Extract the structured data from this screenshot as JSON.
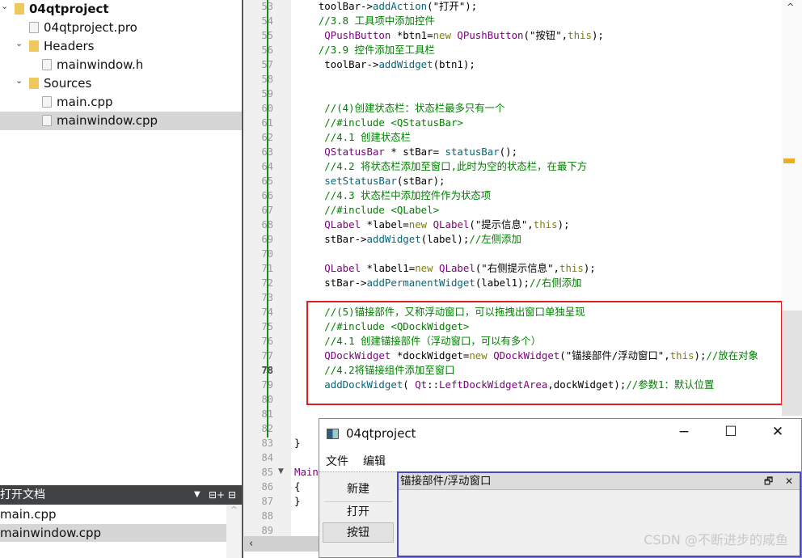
{
  "project_tree": [
    {
      "label": "04qtproject",
      "icon": "qt-project-folder-icon",
      "depth": 0,
      "chevron": "expanded",
      "bold": true
    },
    {
      "label": "04qtproject.pro",
      "icon": "qt-pro-file-icon",
      "depth": 1
    },
    {
      "label": "Headers",
      "icon": "headers-folder-icon",
      "depth": 1,
      "chevron": "expanded"
    },
    {
      "label": "mainwindow.h",
      "icon": "header-file-icon",
      "depth": 2
    },
    {
      "label": "Sources",
      "icon": "sources-folder-icon",
      "depth": 1,
      "chevron": "expanded"
    },
    {
      "label": "main.cpp",
      "icon": "cpp-file-icon",
      "depth": 2
    },
    {
      "label": "mainwindow.cpp",
      "icon": "cpp-file-icon",
      "depth": 2,
      "selected": true
    }
  ],
  "open_docs": {
    "title": "打开文档",
    "items": [
      "main.cpp",
      "mainwindow.cpp"
    ],
    "selected": "mainwindow.cpp"
  },
  "editor": {
    "current_line": 78,
    "lines": [
      {
        "n": 53,
        "t": [
          [
            "",
            "    toolBar->"
          ],
          [
            "f",
            "addAction"
          ],
          [
            "",
            "(\"打开\");"
          ]
        ]
      },
      {
        "n": 54,
        "t": [
          [
            "c",
            "    //3.8 工具项中添加控件"
          ]
        ]
      },
      {
        "n": 55,
        "t": [
          [
            "k",
            "     QPushButton"
          ],
          [
            "",
            " *btn1="
          ],
          [
            "o",
            "new"
          ],
          [
            "k",
            " QPushButton"
          ],
          [
            "",
            "(\"按钮\","
          ],
          [
            "o",
            "this"
          ],
          [
            "",
            ");"
          ]
        ]
      },
      {
        "n": 56,
        "t": [
          [
            "c",
            "    //3.9 控件添加至工具栏"
          ]
        ]
      },
      {
        "n": 57,
        "t": [
          [
            "",
            "     toolBar->"
          ],
          [
            "f",
            "addWidget"
          ],
          [
            "",
            "(btn1);"
          ]
        ]
      },
      {
        "n": 58,
        "t": []
      },
      {
        "n": 59,
        "t": []
      },
      {
        "n": 60,
        "t": [
          [
            "c",
            "     //(4)创建状态栏：状态栏最多只有一个"
          ]
        ]
      },
      {
        "n": 61,
        "t": [
          [
            "c",
            "     //#include <QStatusBar>"
          ]
        ]
      },
      {
        "n": 62,
        "t": [
          [
            "c",
            "     //4.1 创建状态栏"
          ]
        ]
      },
      {
        "n": 63,
        "t": [
          [
            "k",
            "     QStatusBar"
          ],
          [
            "",
            " * stBar= "
          ],
          [
            "f",
            "statusBar"
          ],
          [
            "",
            "();"
          ]
        ]
      },
      {
        "n": 64,
        "t": [
          [
            "c",
            "     //4.2 将状态栏添加至窗口,此时为空的状态栏，在最下方"
          ]
        ]
      },
      {
        "n": 65,
        "t": [
          [
            "f",
            "     setStatusBar"
          ],
          [
            "",
            "(stBar);"
          ]
        ]
      },
      {
        "n": 66,
        "t": [
          [
            "c",
            "     //4.3 状态栏中添加控件作为状态项"
          ]
        ]
      },
      {
        "n": 67,
        "t": [
          [
            "c",
            "     //#include <QLabel>"
          ]
        ]
      },
      {
        "n": 68,
        "t": [
          [
            "k",
            "     QLabel"
          ],
          [
            "",
            " *label="
          ],
          [
            "o",
            "new"
          ],
          [
            "k",
            " QLabel"
          ],
          [
            "",
            "(\"提示信息\","
          ],
          [
            "o",
            "this"
          ],
          [
            "",
            ");"
          ]
        ]
      },
      {
        "n": 69,
        "t": [
          [
            "",
            "     stBar->"
          ],
          [
            "f",
            "addWidget"
          ],
          [
            "",
            "(label);"
          ],
          [
            "c",
            "//左侧添加"
          ]
        ]
      },
      {
        "n": 70,
        "t": []
      },
      {
        "n": 71,
        "t": [
          [
            "k",
            "     QLabel"
          ],
          [
            "",
            " *label1="
          ],
          [
            "o",
            "new"
          ],
          [
            "k",
            " QLabel"
          ],
          [
            "",
            "(\"右侧提示信息\","
          ],
          [
            "o",
            "this"
          ],
          [
            "",
            ");"
          ]
        ]
      },
      {
        "n": 72,
        "t": [
          [
            "",
            "     stBar->"
          ],
          [
            "f",
            "addPermanentWidget"
          ],
          [
            "",
            "(label1);"
          ],
          [
            "c",
            "//右侧添加"
          ]
        ]
      },
      {
        "n": 73,
        "t": []
      },
      {
        "n": 74,
        "t": [
          [
            "c",
            "     //(5)锚接部件，又称浮动窗口，可以拖拽出窗口单独呈现"
          ]
        ]
      },
      {
        "n": 75,
        "t": [
          [
            "c",
            "     //#include <QDockWidget>"
          ]
        ]
      },
      {
        "n": 76,
        "t": [
          [
            "c",
            "     //4.1 创建锚接部件（浮动窗口，可以有多个）"
          ]
        ]
      },
      {
        "n": 77,
        "t": [
          [
            "k",
            "     QDockWidget"
          ],
          [
            "",
            " *dockWidget="
          ],
          [
            "o",
            "new"
          ],
          [
            "k",
            " QDockWidget"
          ],
          [
            "",
            "(\"锚接部件/浮动窗口\","
          ],
          [
            "o",
            "this"
          ],
          [
            "",
            ");"
          ],
          [
            "c",
            "//放在对象"
          ]
        ]
      },
      {
        "n": 78,
        "t": [
          [
            "c",
            "     //4.2将锚接组件添加至窗口"
          ]
        ]
      },
      {
        "n": 79,
        "t": [
          [
            "f",
            "     addDockWidget"
          ],
          [
            "",
            "( "
          ],
          [
            "k",
            "Qt"
          ],
          [
            "",
            "::"
          ],
          [
            "k",
            "LeftDockWidgetArea"
          ],
          [
            "",
            ",dockWidget);"
          ],
          [
            "c",
            "//参数1：默认位置"
          ]
        ]
      },
      {
        "n": 80,
        "t": []
      },
      {
        "n": 81,
        "t": []
      },
      {
        "n": 82,
        "t": []
      },
      {
        "n": 83,
        "t": [
          [
            "",
            "}"
          ]
        ]
      },
      {
        "n": 84,
        "t": []
      },
      {
        "n": 85,
        "t": [
          [
            "k",
            "Main"
          ]
        ]
      },
      {
        "n": 86,
        "t": [
          [
            "",
            "{"
          ]
        ]
      },
      {
        "n": 87,
        "t": [
          [
            "",
            "}"
          ]
        ]
      },
      {
        "n": 88,
        "t": []
      },
      {
        "n": 89,
        "t": []
      }
    ]
  },
  "qt_window": {
    "title": "04qtproject",
    "controls": {
      "minimize": "−",
      "maximize": "☐",
      "close": "✕"
    },
    "menus": [
      "文件",
      "编辑"
    ],
    "toolbar": [
      {
        "label": "新建"
      },
      {
        "label": "打开"
      },
      {
        "label": "按钮",
        "pressed": true
      }
    ],
    "dock": {
      "title": "锚接部件/浮动窗口",
      "float": "🗗",
      "close": "✕"
    }
  },
  "watermark": "CSDN @不断进步的咸鱼",
  "colors": {
    "keyword": "#800080",
    "function": "#00677c",
    "comment": "#008000",
    "literal": "#808000",
    "highlight_box": "#e02020",
    "dock_border": "#4848c8"
  }
}
